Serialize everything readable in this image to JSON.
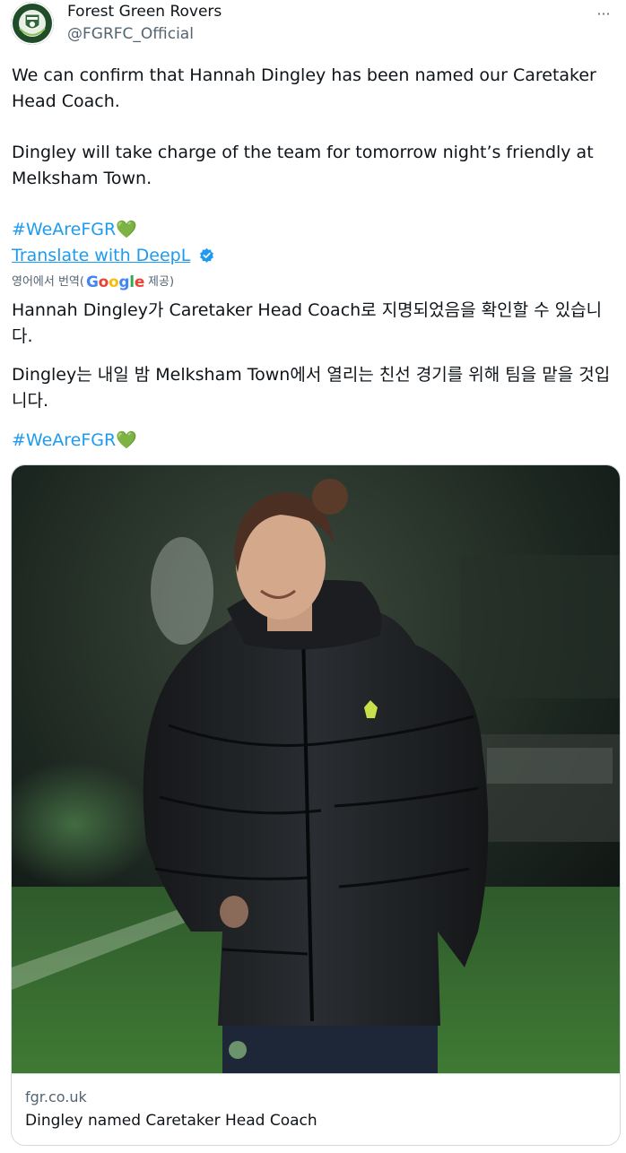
{
  "author": {
    "name": "Forest Green Rovers",
    "handle": "@FGRFC_Official",
    "avatar_icon": "fgr-crest-icon",
    "more_icon": "more-options-icon"
  },
  "tweet": {
    "paragraph1": "We can confirm that Hannah Dingley has been named our Caretaker Head Coach.",
    "paragraph2": "Dingley will take charge of the team for tomorrow night’s friendly at Melksham Town.",
    "hashtag": "#WeAreFGR",
    "heart": "💚"
  },
  "translation": {
    "link_label": "Translate with DeepL",
    "badge_icon": "deepl-verified-badge-icon",
    "google_prefix": "영어에서 번역(",
    "google_word": "Google",
    "google_suffix": "제공)",
    "paragraph1": "Hannah Dingley가 Caretaker Head Coach로 지명되었음을 확인할 수 있습니다.",
    "paragraph2": "Dingley는 내일 밤 Melksham Town에서 열리는 친선 경기를 위해 팀을 맡을 것입니다.",
    "hashtag": "#WeAreFGR",
    "heart": "💚"
  },
  "card": {
    "image_alt": "photo of coach in black puffer jacket on pitch at night",
    "domain": "fgr.co.uk",
    "title": "Dingley named Caretaker Head Coach"
  },
  "colors": {
    "link": "#1d9bf0",
    "text": "#0f1419",
    "muted": "#536471",
    "border": "#cfd9de"
  }
}
